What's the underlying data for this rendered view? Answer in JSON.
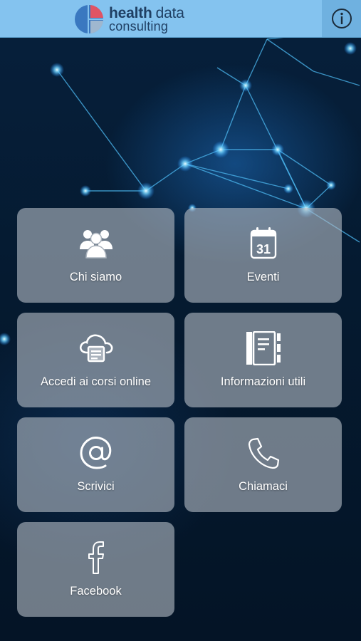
{
  "header": {
    "logo_line1_a": "health",
    "logo_line1_b": "data",
    "logo_line2": "consulting",
    "info_icon": "info-icon"
  },
  "tiles": [
    {
      "label": "Chi siamo",
      "icon": "group-icon"
    },
    {
      "label": "Eventi",
      "icon": "calendar-icon",
      "icon_text": "31"
    },
    {
      "label": "Accedi ai corsi online",
      "icon": "cloud-course-icon"
    },
    {
      "label": "Informazioni utili",
      "icon": "notebook-icon"
    },
    {
      "label": "Scrivici",
      "icon": "at-icon"
    },
    {
      "label": "Chiamaci",
      "icon": "phone-icon"
    },
    {
      "label": "Facebook",
      "icon": "facebook-icon"
    }
  ],
  "colors": {
    "header_bg": "#84c3ef",
    "info_bg": "#6fb1e0",
    "logo_text": "#1f3f63",
    "logo_red": "#e05464",
    "logo_blue": "#3a78c0",
    "tile_bg": "#b2bac4"
  }
}
